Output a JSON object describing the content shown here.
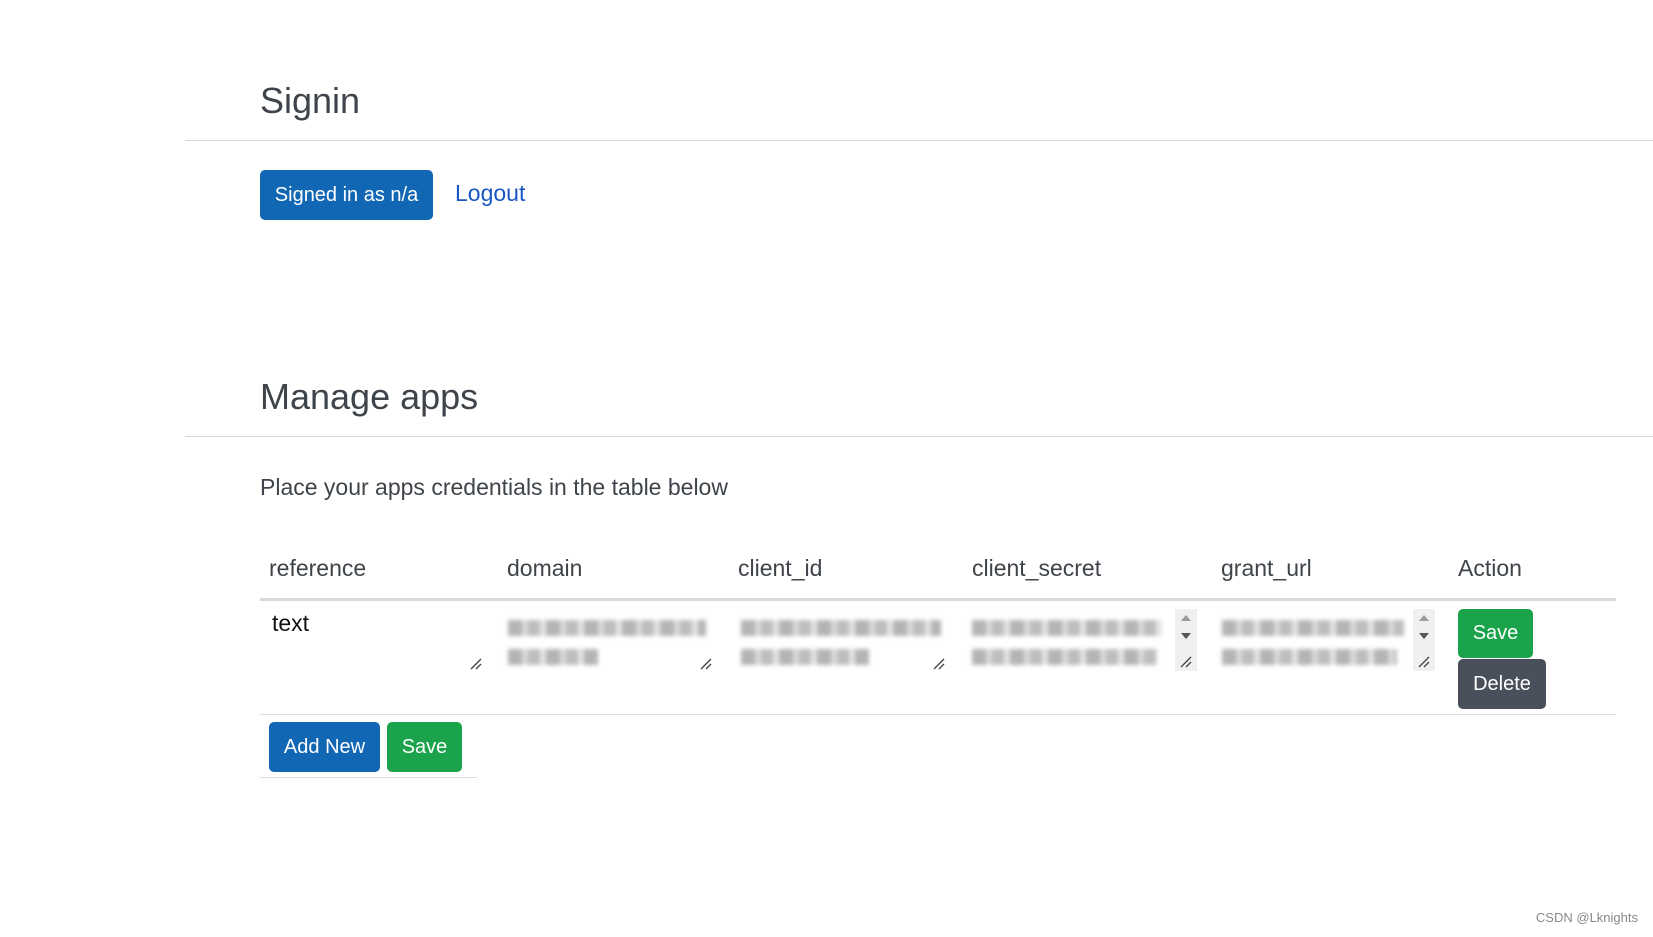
{
  "signin": {
    "title": "Signin",
    "signed_in_label": "Signed in as n/a",
    "logout_label": "Logout"
  },
  "manage": {
    "title": "Manage apps",
    "description": "Place your apps credentials in the table below",
    "columns": [
      "reference",
      "domain",
      "client_id",
      "client_secret",
      "grant_url",
      "Action"
    ],
    "rows": [
      {
        "reference": "text",
        "domain": "",
        "client_id": "",
        "client_secret": "",
        "grant_url": "",
        "actions": {
          "save_label": "Save",
          "delete_label": "Delete"
        }
      }
    ],
    "add_new_label": "Add New",
    "save_all_label": "Save"
  },
  "watermark": "CSDN @Lknights",
  "colors": {
    "primary": "#1267b5",
    "success": "#1aa34a",
    "dark": "#4a4f5c",
    "link": "#1a56c4"
  }
}
